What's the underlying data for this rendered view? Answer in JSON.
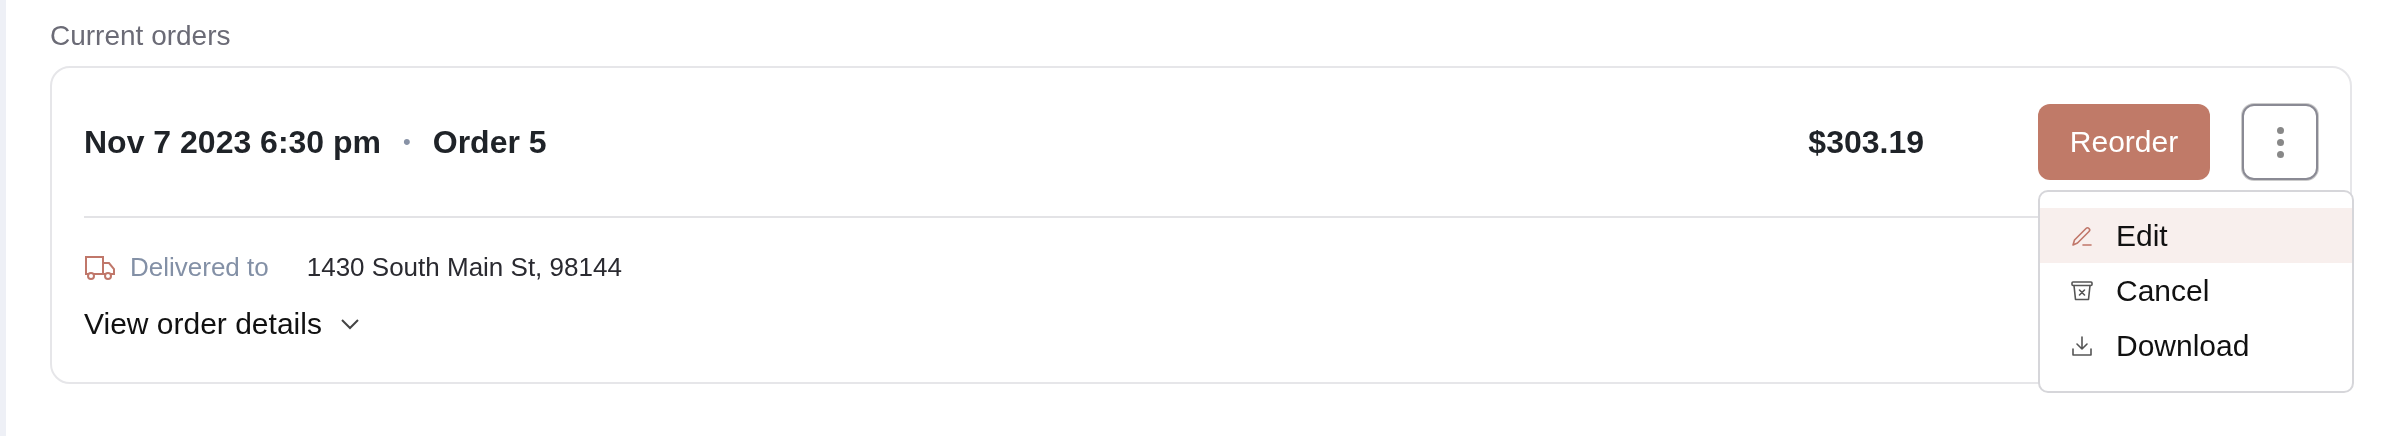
{
  "section_title": "Current orders",
  "order": {
    "date": "Nov 7 2023 6:30 pm",
    "separator": "•",
    "number": "Order 5",
    "total": "$303.19",
    "delivery_label": "Delivered to",
    "address": "1430 South Main St, 98144",
    "details_link": "View order details",
    "details_expanded": false
  },
  "actions": {
    "reorder": "Reorder",
    "more_menu_open": true
  },
  "menu": [
    {
      "kind": "edit",
      "label": "Edit",
      "highlighted": true
    },
    {
      "kind": "cancel",
      "label": "Cancel",
      "highlighted": false
    },
    {
      "kind": "download",
      "label": "Download",
      "highlighted": false
    }
  ]
}
